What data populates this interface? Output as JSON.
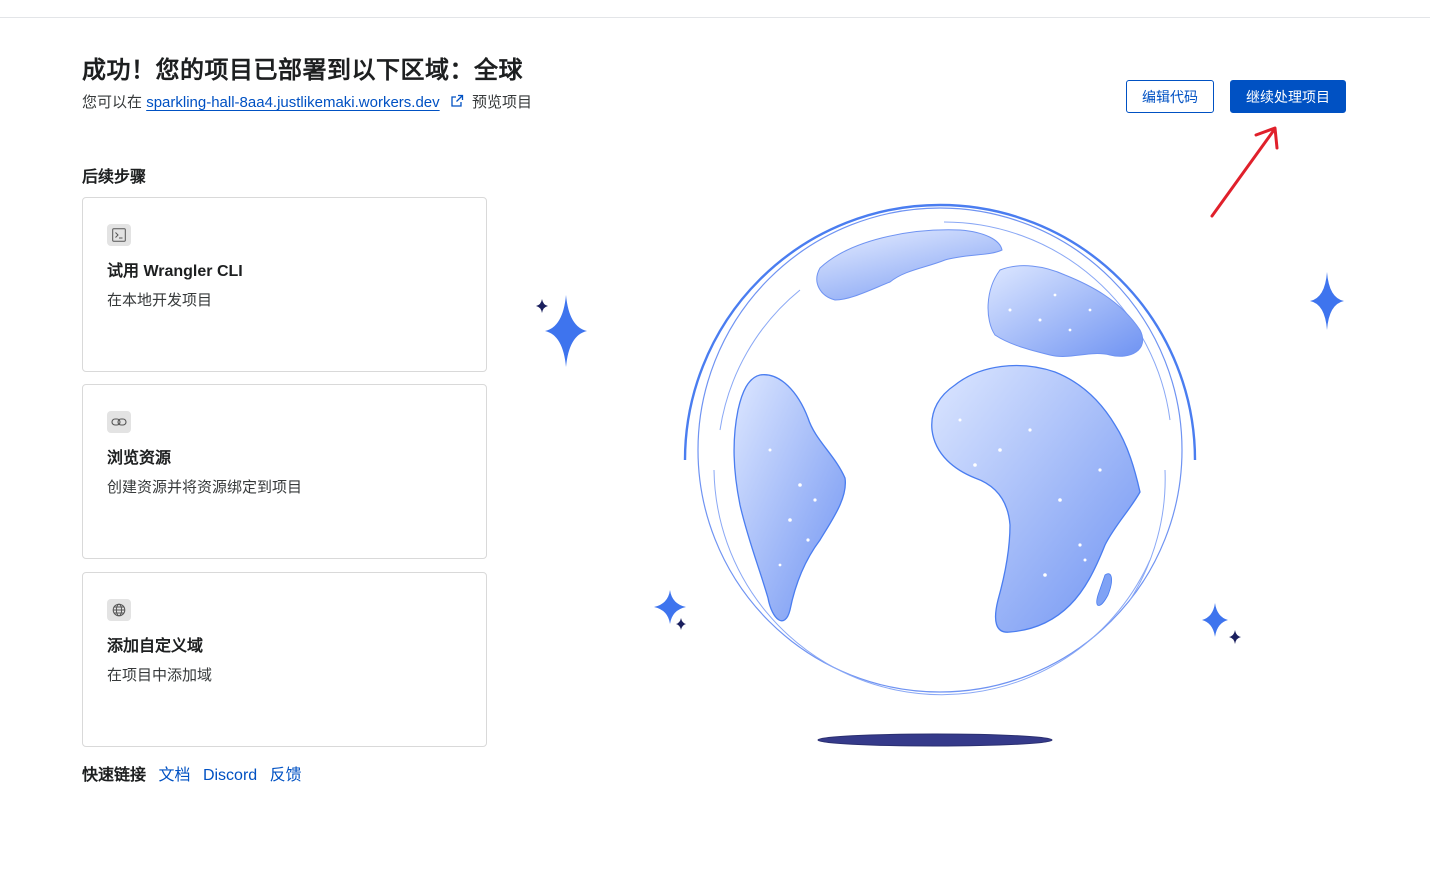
{
  "header": {
    "title": "成功！您的项目已部署到以下区域：全球",
    "subtitle_prefix": "您可以在",
    "preview_url": "sparkling-hall-8aa4.justlikemaki.workers.dev",
    "subtitle_suffix": "预览项目"
  },
  "actions": {
    "edit_code_label": "编辑代码",
    "continue_label": "继续处理项目"
  },
  "next_steps": {
    "title": "后续步骤",
    "cards": [
      {
        "icon": "terminal-icon",
        "title": "试用 Wrangler CLI",
        "description": "在本地开发项目"
      },
      {
        "icon": "link-icon",
        "title": "浏览资源",
        "description": "创建资源并将资源绑定到项目"
      },
      {
        "icon": "globe-icon",
        "title": "添加自定义域",
        "description": "在项目中添加域"
      }
    ]
  },
  "quick_links": {
    "label": "快速链接",
    "links": [
      "文档",
      "Discord",
      "反馈"
    ]
  },
  "colors": {
    "accent": "#0051c3",
    "globe_light": "#dfe8ff",
    "globe_mid": "#7fa2f5",
    "annotation_arrow": "#e0202b"
  }
}
